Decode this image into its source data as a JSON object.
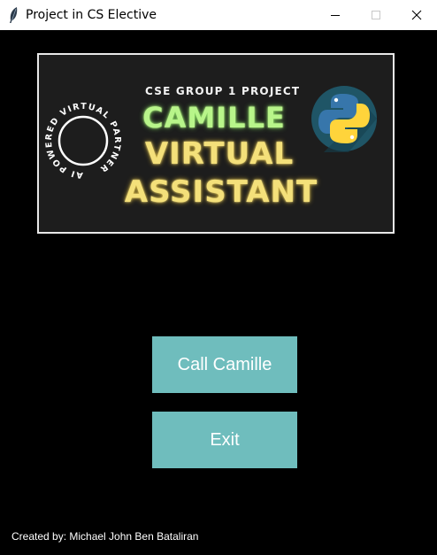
{
  "window": {
    "title": "Project in CS Elective",
    "icon": "feather-icon",
    "controls": [
      "minimize-icon",
      "maximize-icon",
      "close-icon"
    ]
  },
  "banner": {
    "circular_text": "AI POWERED VIRTUAL PARTNER",
    "subtitle": "CSE GROUP 1 PROJECT",
    "line1": "CAMILLE",
    "line2": "VIRTUAL",
    "line3": "ASSISTANT",
    "logo": "python-logo",
    "colors": {
      "background": "#1d1d1d",
      "line1": "#b8f58a",
      "line2": "#f4e07a",
      "python_blue": "#3776ab",
      "python_yellow": "#ffd43b",
      "logo_circle": "#1f5566"
    }
  },
  "buttons": {
    "call": "Call Camille",
    "exit": "Exit"
  },
  "footer": {
    "credit": "Created by: Michael John Ben Bataliran"
  },
  "colors": {
    "window_background": "#000000",
    "button": "#6fbdbd",
    "button_text": "#ffffff"
  }
}
